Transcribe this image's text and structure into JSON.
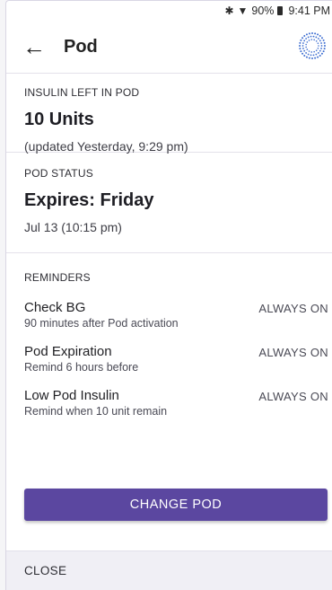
{
  "status_bar": {
    "bluetooth": "✱",
    "wifi": "▼",
    "battery": "90%",
    "time": "9:41 PM"
  },
  "header": {
    "title": "Pod",
    "back_glyph": "←"
  },
  "insulin": {
    "label": "INSULIN LEFT IN POD",
    "value": "10 Units",
    "updated": "(updated Yesterday, 9:29 pm)"
  },
  "pod_status": {
    "label": "POD STATUS",
    "value": "Expires: Friday",
    "detail": "Jul 13 (10:15 pm)"
  },
  "reminders": {
    "label": "REMINDERS",
    "items": [
      {
        "name": "Check BG",
        "detail": "90 minutes after Pod activation",
        "state": "ALWAYS ON"
      },
      {
        "name": "Pod Expiration",
        "detail": "Remind 6 hours before",
        "state": "ALWAYS ON"
      },
      {
        "name": "Low Pod Insulin",
        "detail": "Remind when 10 unit remain",
        "state": "ALWAYS ON"
      }
    ]
  },
  "actions": {
    "change_pod": "CHANGE POD",
    "close": "CLOSE"
  },
  "colors": {
    "accent": "#5b47a0",
    "pod_icon": "#3f6fd1"
  }
}
